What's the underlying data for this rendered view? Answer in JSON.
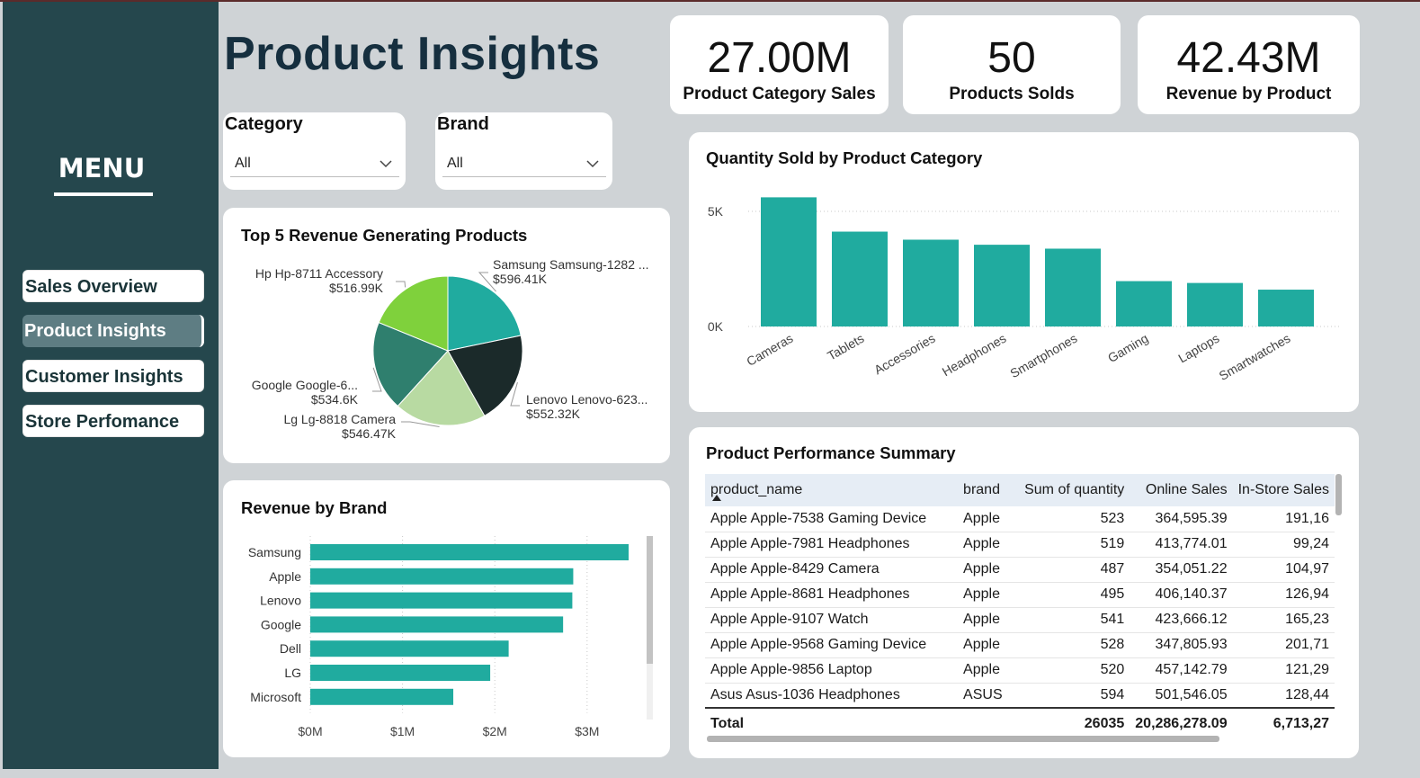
{
  "title": "Product Insights",
  "menu": {
    "title": "MENU",
    "items": [
      {
        "label": "Sales Overview",
        "active": false
      },
      {
        "label": "Product Insights",
        "active": true
      },
      {
        "label": "Customer Insights",
        "active": false
      },
      {
        "label": "Store Perfomance",
        "active": false
      }
    ]
  },
  "kpis": [
    {
      "value": "27.00M",
      "label": "Product Category Sales"
    },
    {
      "value": "50",
      "label": "Products Solds"
    },
    {
      "value": "42.43M",
      "label": "Revenue by Product"
    }
  ],
  "filters": {
    "category": {
      "label": "Category",
      "value": "All"
    },
    "brand": {
      "label": "Brand",
      "value": "All"
    }
  },
  "colors": {
    "teal": "#20ab9f",
    "sidebar": "#25474d",
    "title": "#162f3f"
  },
  "chart_data": [
    {
      "type": "pie",
      "title": "Top 5 Revenue Generating Products",
      "slices": [
        {
          "label": "Samsung Samsung-1282 ...",
          "value_label": "$596.41K",
          "value": 596.41,
          "color": "#20ab9f"
        },
        {
          "label": "Lenovo Lenovo-623...",
          "value_label": "$552.32K",
          "value": 552.32,
          "color": "#1b2a2a"
        },
        {
          "label": "Lg Lg-8818 Camera",
          "value_label": "$546.47K",
          "value": 546.47,
          "color": "#b8daa2"
        },
        {
          "label": "Google Google-6...",
          "value_label": "$534.6K",
          "value": 534.6,
          "color": "#2f7f6e"
        },
        {
          "label": "Hp Hp-8711 Accessory",
          "value_label": "$516.99K",
          "value": 516.99,
          "color": "#7fd13c"
        }
      ]
    },
    {
      "type": "bar",
      "orientation": "horizontal",
      "title": "Revenue by Brand",
      "categories": [
        "Samsung",
        "Apple",
        "Lenovo",
        "Google",
        "Dell",
        "LG",
        "Microsoft"
      ],
      "values": [
        3.45,
        2.85,
        2.84,
        2.74,
        2.15,
        1.95,
        1.55
      ],
      "xlim": [
        0,
        3.45
      ],
      "xticks": [
        0,
        1,
        2,
        3
      ],
      "xtick_labels": [
        "$0M",
        "$1M",
        "$2M",
        "$3M"
      ],
      "grid": true
    },
    {
      "type": "bar",
      "title": "Quantity Sold by Product Category",
      "categories": [
        "Cameras",
        "Tablets",
        "Accessories",
        "Headphones",
        "Smartphones",
        "Gaming",
        "Laptops",
        "Smartwatches"
      ],
      "values": [
        5610,
        4120,
        3770,
        3550,
        3380,
        1970,
        1890,
        1600
      ],
      "ylim": [
        0,
        6000
      ],
      "yticks": [
        0,
        5000
      ],
      "ytick_labels": [
        "0K",
        "5K"
      ],
      "grid": true
    }
  ],
  "table": {
    "title": "Product Performance Summary",
    "columns": [
      "product_name",
      "brand",
      "Sum of quantity",
      "Online Sales",
      "In-Store Sales"
    ],
    "rows": [
      [
        "Apple Apple-7538 Gaming Device",
        "Apple",
        "523",
        "364,595.39",
        "191,16"
      ],
      [
        "Apple Apple-7981 Headphones",
        "Apple",
        "519",
        "413,774.01",
        "99,24"
      ],
      [
        "Apple Apple-8429 Camera",
        "Apple",
        "487",
        "354,051.22",
        "104,97"
      ],
      [
        "Apple Apple-8681 Headphones",
        "Apple",
        "495",
        "406,140.37",
        "126,94"
      ],
      [
        "Apple Apple-9107 Watch",
        "Apple",
        "541",
        "423,666.12",
        "165,23"
      ],
      [
        "Apple Apple-9568 Gaming Device",
        "Apple",
        "528",
        "347,805.93",
        "201,71"
      ],
      [
        "Apple Apple-9856 Laptop",
        "Apple",
        "520",
        "457,142.79",
        "121,29"
      ],
      [
        "Asus Asus-1036 Headphones",
        "ASUS",
        "594",
        "501,546.05",
        "128,44"
      ]
    ],
    "total": [
      "Total",
      "",
      "26035",
      "20,286,278.09",
      "6,713,27"
    ]
  }
}
